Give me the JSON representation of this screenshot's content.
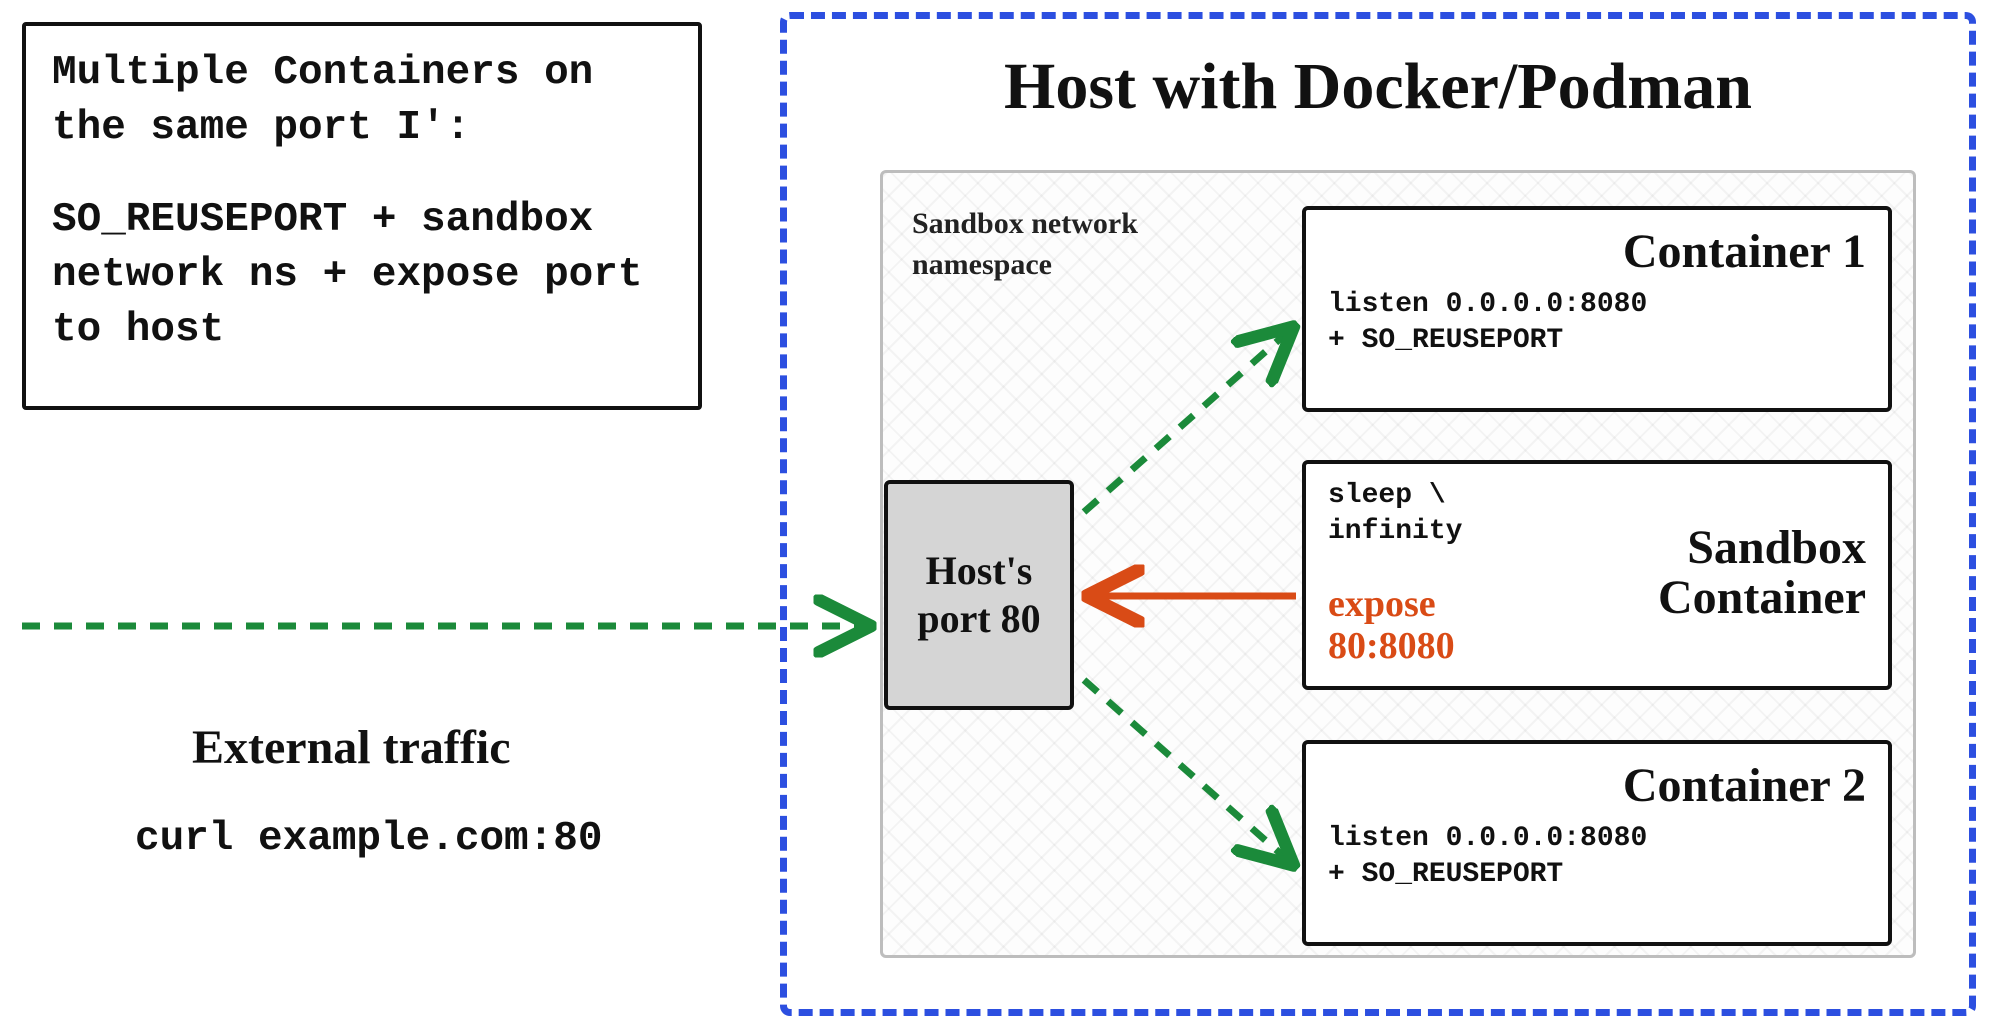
{
  "caption": {
    "line1": "Multiple Containers on the same port I':",
    "line2": "SO_REUSEPORT + sandbox network ns + expose port to host"
  },
  "external": {
    "title": "External traffic",
    "command": "curl example.com:80"
  },
  "host": {
    "title": "Host with Docker/Podman",
    "port_label": "Host's port 80"
  },
  "sandbox_area": {
    "label": "Sandbox network namespace"
  },
  "containers": {
    "c1": {
      "title": "Container 1",
      "listen": "listen 0.0.0.0:8080",
      "opt": "+ SO_REUSEPORT"
    },
    "sandbox": {
      "title": "Sandbox Container",
      "cmd_line1": "sleep \\",
      "cmd_line2": "infinity",
      "expose_line1": "expose",
      "expose_line2": "80:8080"
    },
    "c2": {
      "title": "Container 2",
      "listen": "listen 0.0.0.0:8080",
      "opt": "+ SO_REUSEPORT"
    }
  },
  "colors": {
    "blue_dash": "#2c4fe0",
    "green": "#1b8a3a",
    "orange": "#d94b16",
    "grey_fill": "#d5d5d5"
  }
}
